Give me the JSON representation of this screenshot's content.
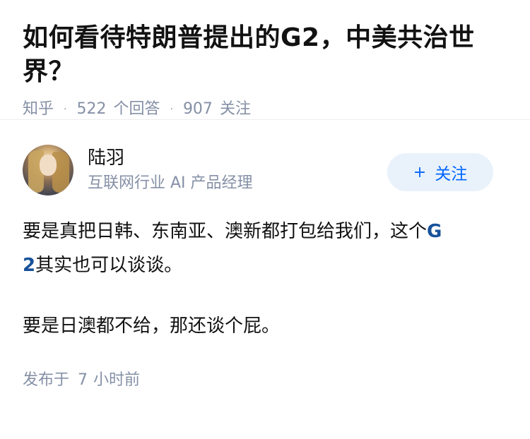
{
  "question": {
    "title": "如何看待特朗普提出的G2，中美共治世界？",
    "source": "知乎",
    "separator": "·",
    "answer_count": "522",
    "answer_label": "个回答",
    "follower_count": "907",
    "follower_label": "关注"
  },
  "answer": {
    "author": {
      "name": "陆羽",
      "headline": "互联网行业 AI 产品经理",
      "avatar_icon": "avatar-blonde-woman"
    },
    "follow_button": {
      "icon": "+",
      "label": "关注"
    },
    "paragraph1_before": "要是真把日韩、东南亚、澳新都打包给我们，这个",
    "paragraph1_link_part1": "G",
    "paragraph1_link_part2": "2",
    "paragraph1_after": "其实也可以谈谈。",
    "paragraph2": "要是日澳都不给，那还谈个屁。",
    "publish_label": "发布于",
    "publish_num": "7",
    "publish_unit": "小时前"
  },
  "colors": {
    "accent": "#0066ff",
    "link": "#175199",
    "meta": "#8590a6",
    "follow_bg": "#e9f2fb"
  }
}
